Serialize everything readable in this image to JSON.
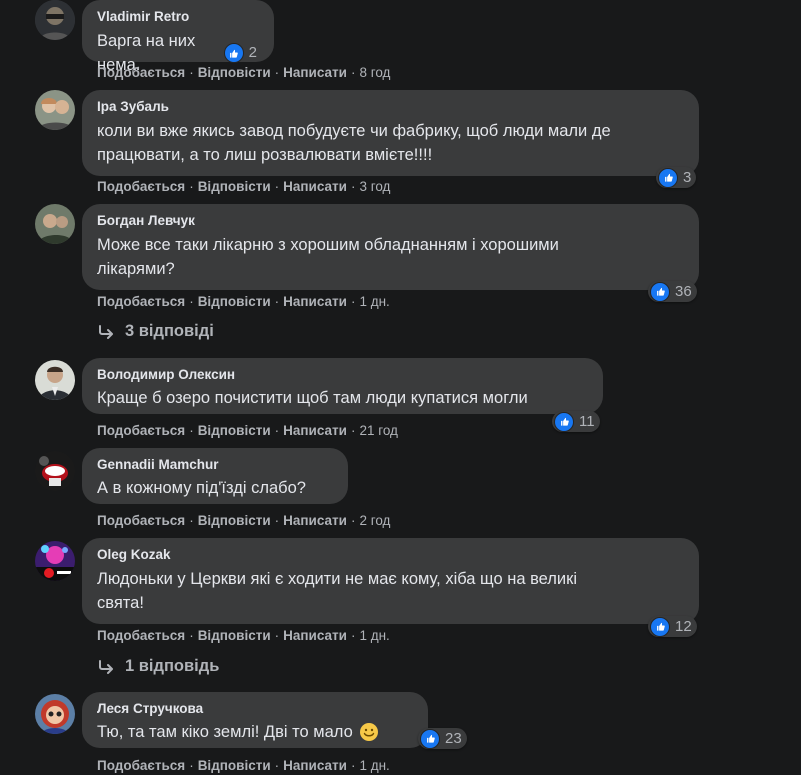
{
  "actions": {
    "like": "Подобається",
    "reply": "Відповісти",
    "write": "Написати",
    "sep": "·"
  },
  "comments": [
    {
      "author": "Vladimir Retro",
      "text": "Варга на них нема.",
      "reactions": "2",
      "time": "8 год"
    },
    {
      "author": "Іра Зубаль",
      "text_lines": [
        "коли ви вже якись завод побудуєте чи фабрику, щоб люди мали де",
        "працювати, а то лиш розвалювати вмієте!!!!"
      ],
      "reactions": "3",
      "time": "3 год"
    },
    {
      "author": "Богдан Левчук",
      "text_lines": [
        "Може все таки лікарню з хорошим обладнанням і хорошими",
        "лікарями?"
      ],
      "reactions": "36",
      "time": "1 дн.",
      "replies": "3 відповіді"
    },
    {
      "author": "Володимир Олексин",
      "text": "Краще б озеро почистити щоб там люди купатися могли",
      "reactions": "11",
      "time": "21 год"
    },
    {
      "author": "Gennadii Mamchur",
      "text": "А в кожному під'їзді слабо?",
      "time": "2 год"
    },
    {
      "author": "Oleg Kozak",
      "text_lines": [
        "Людоньки у Церкви які є ходити не має кому, хіба що на великі",
        "свята!"
      ],
      "reactions": "12",
      "time": "1 дн.",
      "replies": "1 відповідь"
    },
    {
      "author": "Леся Стручкова",
      "text": "Тю, та там кіко землі! Дві то мало",
      "reactions": "23",
      "time": "1 дн."
    }
  ],
  "colors": {
    "background": "#18191a",
    "bubble": "#3a3b3c",
    "like_blue": "#1877f2",
    "secondary_text": "#b0b3b8"
  },
  "icons": {
    "like": "thumbs-up-icon",
    "reply_arrow": "reply-arrow-icon",
    "emoji": "smiling-face-emoji-icon"
  }
}
